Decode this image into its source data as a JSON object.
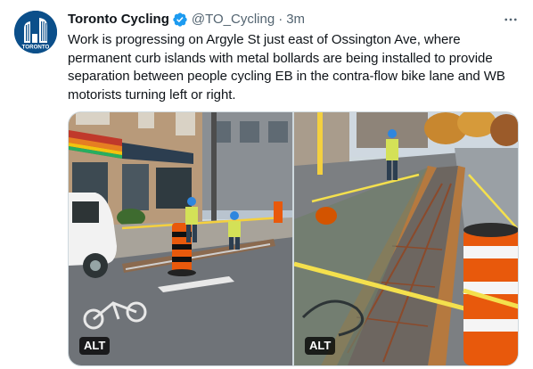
{
  "tweet": {
    "author": {
      "display_name": "Toronto Cycling",
      "handle": "@TO_Cycling",
      "verified": true,
      "avatar_icon": "toronto-city-hall-logo",
      "avatar_text": "TORONTO"
    },
    "separator": "·",
    "timestamp": "3m",
    "more_icon": "more-options-icon",
    "text": "Work is progressing on Argyle St just east of Ossington Ave, where permanent curb islands with metal bollards are being installed to provide separation between people cycling EB in the contra-flow bike lane and WB motorists turning left or right.",
    "media": [
      {
        "alt_label": "ALT",
        "subject": "construction crew installing curb islands beside storefronts on Argyle St"
      },
      {
        "alt_label": "ALT",
        "subject": "curb island formwork with rebar and caution tape in the bike lane"
      }
    ]
  },
  "colors": {
    "text_primary": "#0f1419",
    "text_secondary": "#536471",
    "verified_badge": "#1d9bf0",
    "avatar_bg": "#0b4f8a",
    "border": "#cfd9de"
  }
}
